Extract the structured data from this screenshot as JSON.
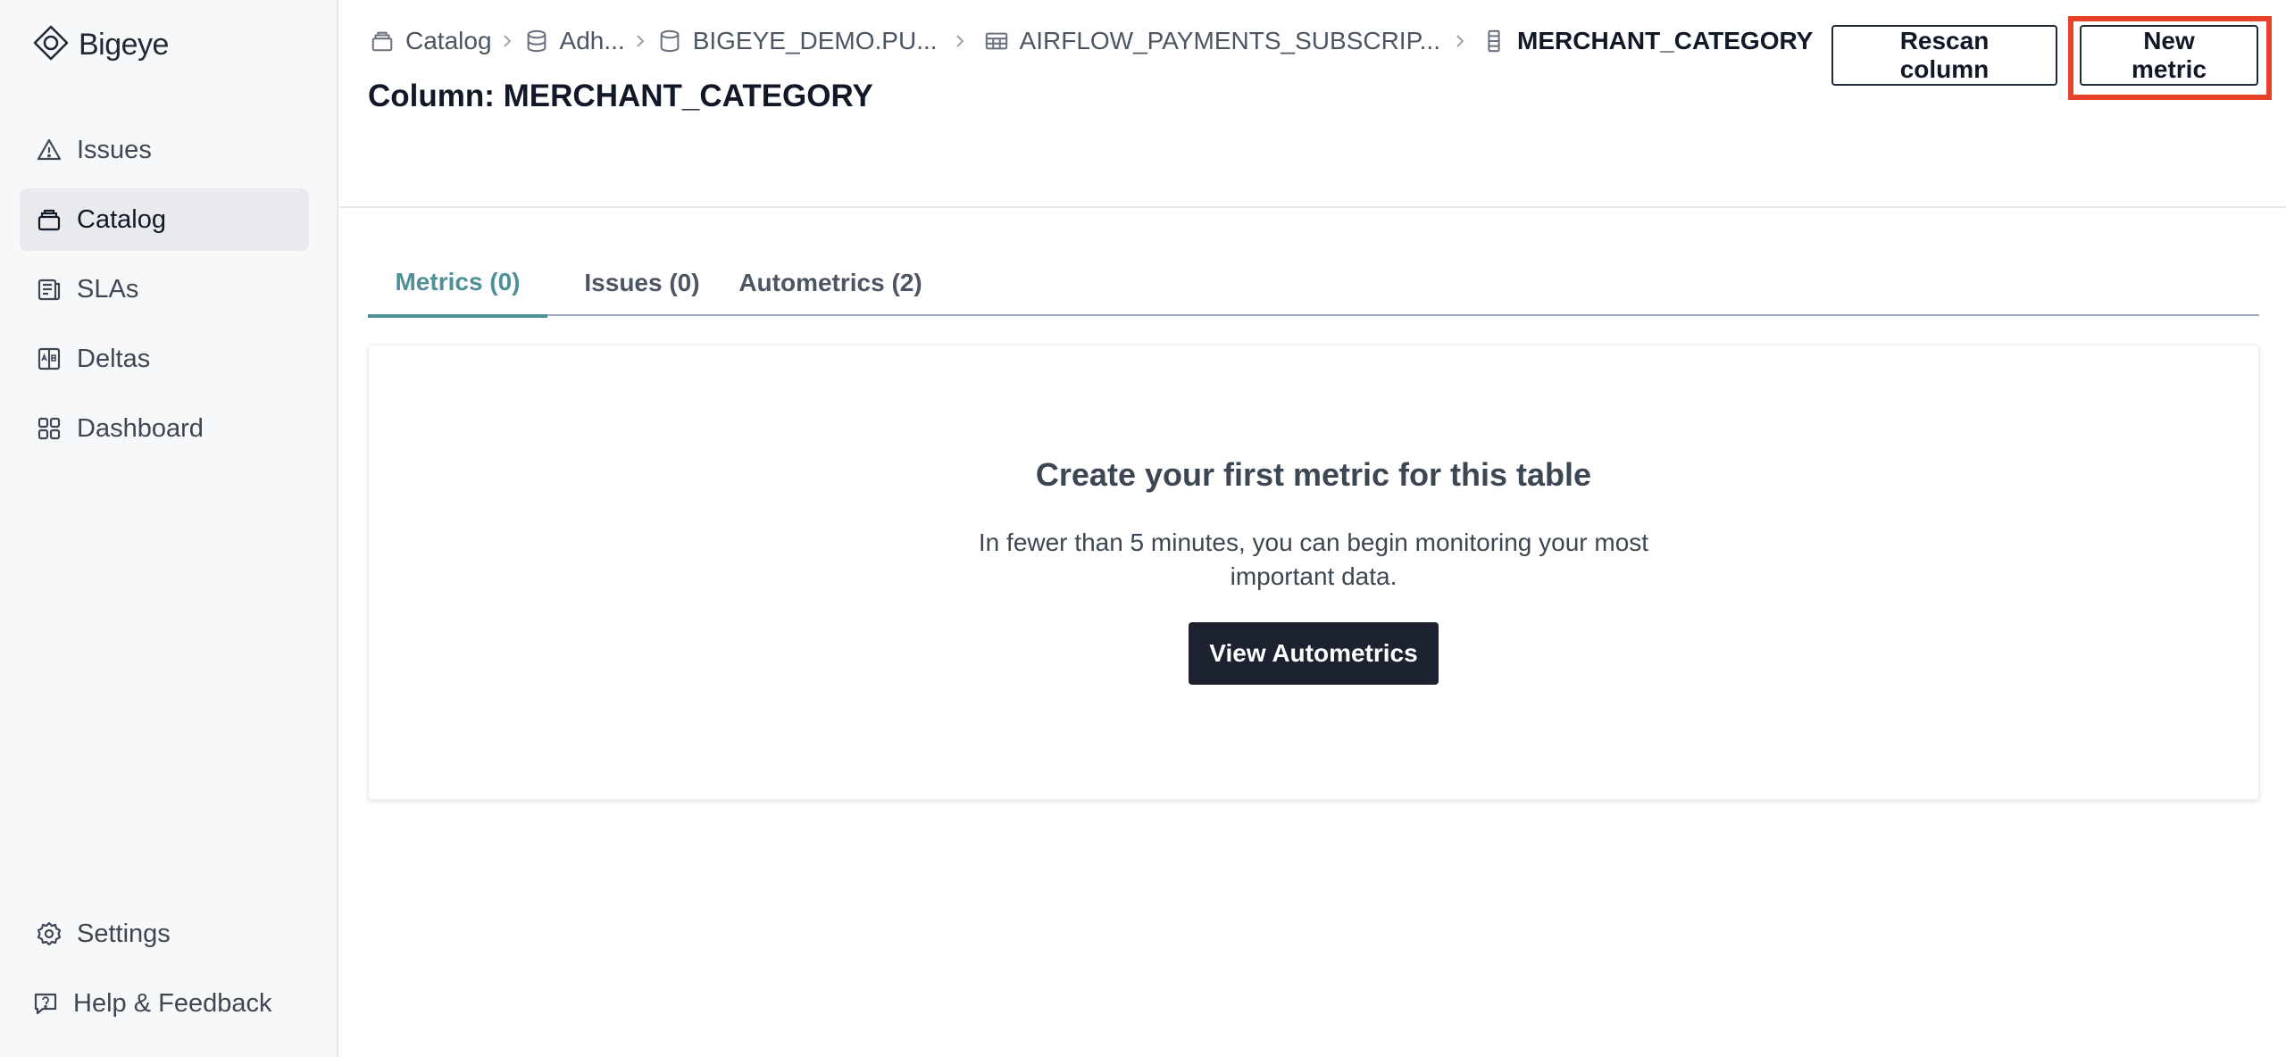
{
  "app": {
    "name": "Bigeye"
  },
  "sidebar": {
    "items": [
      {
        "label": "Issues",
        "icon": "warning-triangle-icon"
      },
      {
        "label": "Catalog",
        "icon": "catalog-icon",
        "active": true
      },
      {
        "label": "SLAs",
        "icon": "sla-icon"
      },
      {
        "label": "Deltas",
        "icon": "deltas-icon"
      },
      {
        "label": "Dashboard",
        "icon": "dashboard-grid-icon"
      }
    ],
    "bottom": [
      {
        "label": "Settings",
        "icon": "gear-icon"
      },
      {
        "label": "Help & Feedback",
        "icon": "help-icon"
      }
    ]
  },
  "breadcrumb": [
    {
      "label": "Catalog",
      "icon": "catalog-icon"
    },
    {
      "label": "Adh...",
      "icon": "database-icon"
    },
    {
      "label": "BIGEYE_DEMO.PU...",
      "icon": "schema-icon"
    },
    {
      "label": "AIRFLOW_PAYMENTS_SUBSCRIP...",
      "icon": "table-icon"
    },
    {
      "label": "MERCHANT_CATEGORY",
      "icon": "column-icon"
    }
  ],
  "header": {
    "title": "Column: MERCHANT_CATEGORY",
    "rescan_label": "Rescan column",
    "new_metric_label": "New metric"
  },
  "tabs": [
    {
      "label": "Metrics (0)",
      "active": true
    },
    {
      "label": "Issues (0)"
    },
    {
      "label": "Autometrics (2)"
    }
  ],
  "empty_state": {
    "title": "Create your first metric for this table",
    "description": "In fewer than 5 minutes, you can begin monitoring your most important data.",
    "button_label": "View Autometrics"
  },
  "colors": {
    "accent_tab": "#4f8f98",
    "primary_button": "#1c2230",
    "highlight": "#e8412a"
  }
}
